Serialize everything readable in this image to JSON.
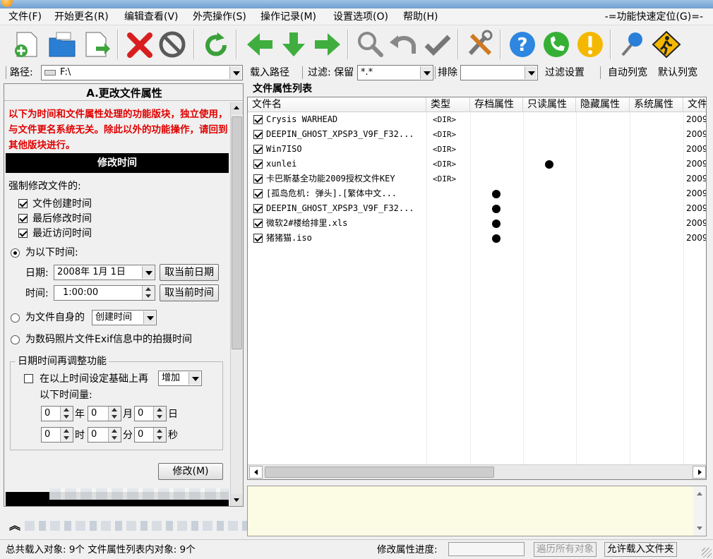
{
  "menu": {
    "items": [
      "文件(F)",
      "开始更名(R)",
      "编辑查看(V)",
      "外壳操作(S)",
      "操作记录(M)",
      "设置选项(O)",
      "帮助(H)"
    ],
    "quick_locate": "-=功能快速定位(G)=-"
  },
  "toolbar": {
    "icons": [
      "add-file-icon",
      "open-folder-icon",
      "export-file-icon",
      "delete-icon",
      "stop-icon",
      "refresh-icon",
      "arrow-left-icon",
      "arrow-down-icon",
      "arrow-right-icon",
      "search-icon",
      "undo-icon",
      "check-icon",
      "tools-icon",
      "help-icon",
      "phone-icon",
      "warning-icon",
      "pin-icon",
      "walker-icon"
    ]
  },
  "pathbar": {
    "path_label": "路径:",
    "path_value": "F:\\",
    "load_path": "载入路径",
    "filter_label": "过滤: 保留",
    "filter_value": "*.*",
    "exclude_label": "排除",
    "exclude_value": "",
    "filter_settings": "过滤设置",
    "auto_width": "自动列宽",
    "default_width": "默认列宽"
  },
  "left": {
    "title": "A.更改文件属性",
    "notice": "以下为时间和文件属性处理的功能版块，独立使用，与文件更名系统无关。除此以外的功能操作，请回到其他版块进行。",
    "section_header": "修改时间",
    "force_label": "强制修改文件的:",
    "chk_created": "文件创建时间",
    "chk_modified": "最后修改时间",
    "chk_accessed": "最近访问时间",
    "radio_time": "为以下时间:",
    "date_label": "日期:",
    "date_value": "2008年  1月  1日",
    "btn_current_date": "取当前日期",
    "time_label": "时间:",
    "time_value": "1:00:00",
    "btn_current_time": "取当前时间",
    "radio_self": "为文件自身的",
    "self_option": "创建时间",
    "radio_exif": "为数码照片文件Exif信息中的拍摄时间",
    "group_title": "日期时间再调整功能",
    "adjust_label": "在以上时间设定基础上再",
    "adjust_option": "增加",
    "adjust_label2": "以下时间量:",
    "spin_year": "0",
    "unit_year": "年",
    "spin_month": "0",
    "unit_month": "月",
    "spin_day": "0",
    "unit_day": "日",
    "spin_hour": "0",
    "unit_hour": "时",
    "spin_min": "0",
    "unit_min": "分",
    "spin_sec": "0",
    "unit_sec": "秒",
    "btn_modify": "修改(M)"
  },
  "list": {
    "title": "文件属性列表",
    "columns": [
      "文件名",
      "类型",
      "存档属性",
      "只读属性",
      "隐藏属性",
      "系统属性",
      "文件"
    ],
    "rows": [
      {
        "name": "Crysis WARHEAD",
        "type": "<DIR>",
        "archive": false,
        "readonly": false,
        "date": "2009"
      },
      {
        "name": "DEEPIN_GHOST_XPSP3_V9F_F32...",
        "type": "<DIR>",
        "archive": false,
        "readonly": false,
        "date": "2009"
      },
      {
        "name": "Win7ISO",
        "type": "<DIR>",
        "archive": false,
        "readonly": false,
        "date": "2009"
      },
      {
        "name": "xunlei",
        "type": "<DIR>",
        "archive": false,
        "readonly": true,
        "date": "2009"
      },
      {
        "name": "卡巴斯基全功能2009授权文件KEY",
        "type": "<DIR>",
        "archive": false,
        "readonly": false,
        "date": "2009"
      },
      {
        "name": "[孤岛危机: 弹头].[繁体中文...",
        "type": "",
        "archive": true,
        "readonly": false,
        "date": "2009"
      },
      {
        "name": "DEEPIN_GHOST_XPSP3_V9F_F32...",
        "type": "",
        "archive": true,
        "readonly": false,
        "date": "2009"
      },
      {
        "name": "微软2#楼给排里.xls",
        "type": "",
        "archive": true,
        "readonly": false,
        "date": "2009"
      },
      {
        "name": "猪猪猫.iso",
        "type": "",
        "archive": true,
        "readonly": false,
        "date": "2009"
      }
    ]
  },
  "status": {
    "loaded": "总共载入对象: 9个  文件属性列表内对象: 9个",
    "progress_label": "修改属性进度:",
    "btn_traverse": "遍历所有对象",
    "btn_allow_folder": "允许载入文件夹"
  }
}
